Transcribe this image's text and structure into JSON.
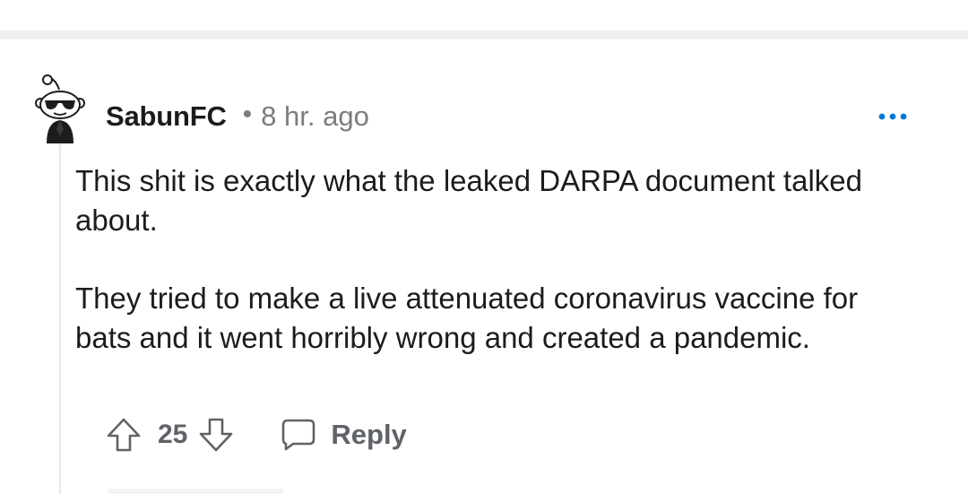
{
  "comment": {
    "avatar_icon": "snoo-sunglasses-avatar-icon",
    "username": "SabunFC",
    "separator": "•",
    "timestamp": "8 hr. ago",
    "more_icon": "more-horizontal-icon",
    "body": [
      "This shit is exactly what the leaked DARPA document talked about.",
      "They tried to make a live attenuated coronavirus vaccine for bats and it went horribly wrong and created a pandemic."
    ],
    "actions": {
      "upvote_icon": "upvote-arrow-icon",
      "score": "25",
      "downvote_icon": "downvote-arrow-icon",
      "reply_icon": "chat-bubble-icon",
      "reply_label": "Reply"
    }
  },
  "colors": {
    "text_primary": "#1c1c1c",
    "text_meta": "#7c7c7c",
    "action_gray": "#5f6368",
    "more_blue": "#0079d3",
    "divider": "#edeff1"
  }
}
